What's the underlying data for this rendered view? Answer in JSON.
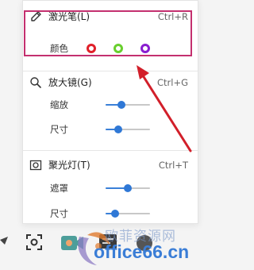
{
  "laser": {
    "label": "激光笔(L)",
    "shortcut": "Ctrl+R",
    "color_label": "颜色",
    "icon": "pen-icon",
    "colors": [
      "#e0202a",
      "#69cf2e",
      "#8a1ed0"
    ]
  },
  "magnifier": {
    "label": "放大镜(G)",
    "shortcut": "Ctrl+G",
    "icon": "magnifier-icon",
    "zoom_label": "缩放",
    "size_label": "尺寸",
    "zoom_level": 0.35,
    "size_level": 0.28
  },
  "spotlight": {
    "label": "聚光灯(T)",
    "shortcut": "Ctrl+T",
    "icon": "spotlight-icon",
    "mask_label": "遮罩",
    "size_label": "尺寸",
    "mask_level": 0.5,
    "size_level": 0.22
  },
  "annotation": {
    "box_color": "#c4306f",
    "arrow_color": "#d21f2a"
  },
  "watermark": {
    "brand": "欧菲资源网",
    "domain": "office66.cn"
  },
  "toolbar": {
    "icons": [
      "pointer-icon",
      "screenshot-icon",
      "camera-icon",
      "chat-icon",
      "more-icon"
    ]
  }
}
